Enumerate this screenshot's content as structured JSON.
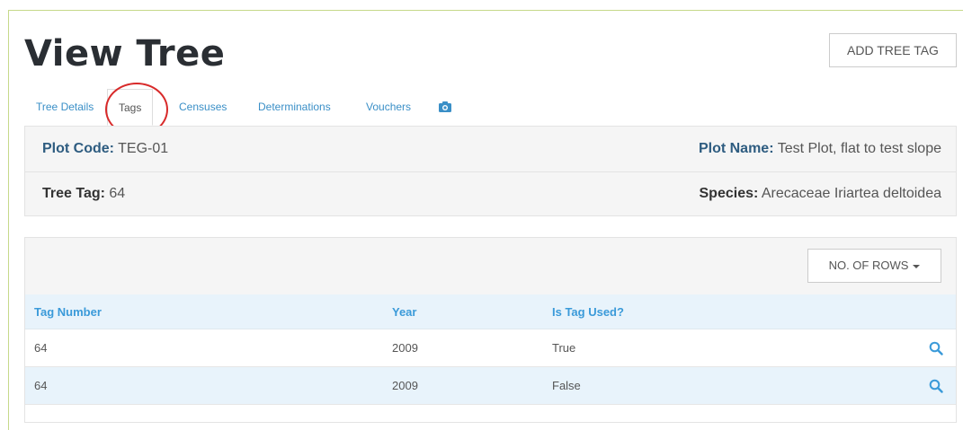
{
  "page": {
    "title": "View Tree"
  },
  "header": {
    "add_tag_label": "ADD TREE TAG"
  },
  "tabs": [
    {
      "label": "Tree Details"
    },
    {
      "label": "Tags"
    },
    {
      "label": "Censuses"
    },
    {
      "label": "Determinations"
    },
    {
      "label": "Vouchers"
    },
    {
      "icon": "camera-icon"
    }
  ],
  "active_tab": "Tags",
  "info": {
    "plot_code_label": "Plot Code:",
    "plot_code": "TEG-01",
    "plot_name_label": "Plot Name:",
    "plot_name": "Test Plot, flat to test slope",
    "tree_tag_label": "Tree Tag:",
    "tree_tag": "64",
    "species_label": "Species:",
    "species": "Arecaceae Iriartea deltoidea"
  },
  "table": {
    "rows_button_label": "NO. OF ROWS",
    "columns": [
      "Tag Number",
      "Year",
      "Is Tag Used?"
    ],
    "rows": [
      [
        "64",
        "2009",
        "True"
      ],
      [
        "64",
        "2009",
        "False"
      ]
    ]
  },
  "colors": {
    "accent": "#3a9ad9",
    "info_label": "#2e5c80",
    "highlight_ring": "#d82a2a"
  }
}
